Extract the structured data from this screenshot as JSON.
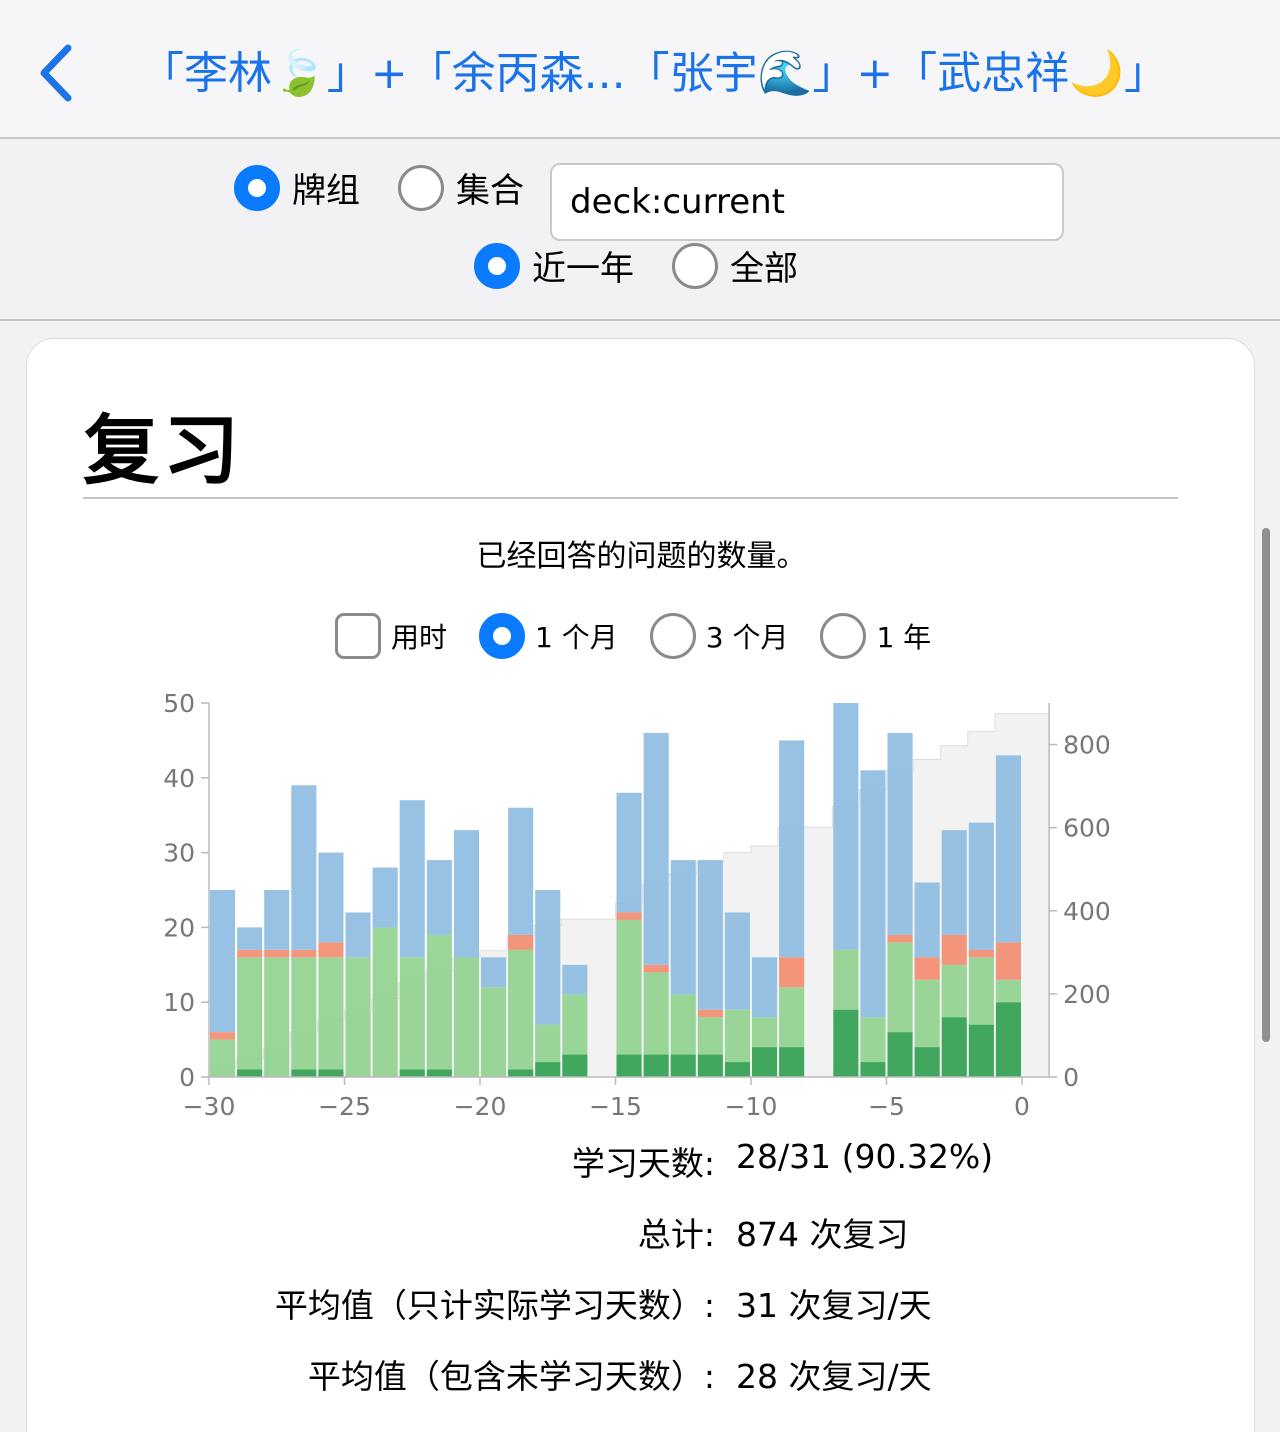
{
  "nav": {
    "back_icon": "chevron-left-icon",
    "title": "「李林🍃」+「余丙森...「张宇🌊」+「武忠祥🌙」",
    "accent": "#1a73e8"
  },
  "filters": {
    "scope_options": [
      {
        "label": "牌组",
        "selected": true
      },
      {
        "label": "集合",
        "selected": false
      }
    ],
    "search_value": "deck:current",
    "period_options": [
      {
        "label": "近一年",
        "selected": true
      },
      {
        "label": "全部",
        "selected": false
      }
    ]
  },
  "card": {
    "title": "复习",
    "subtitle": "已经回答的问题的数量。",
    "time_checkbox": {
      "label": "用时",
      "checked": false
    },
    "range_options": [
      {
        "label": "1 个月",
        "selected": true
      },
      {
        "label": "3 个月",
        "selected": false
      },
      {
        "label": "1 年",
        "selected": false
      }
    ]
  },
  "chart_data": {
    "type": "bar",
    "stacked": true,
    "x": [
      -30,
      -29,
      -28,
      -27,
      -26,
      -25,
      -24,
      -23,
      -22,
      -21,
      -20,
      -19,
      -18,
      -17,
      -16,
      -15,
      -14,
      -13,
      -12,
      -11,
      -10,
      -9,
      -8,
      -7,
      -6,
      -5,
      -4,
      -3,
      -2,
      -1,
      0
    ],
    "series": [
      {
        "key": "mature",
        "color": "#2e9e4f",
        "values": [
          0,
          1,
          0,
          1,
          1,
          0,
          0,
          1,
          1,
          0,
          0,
          1,
          2,
          3,
          0,
          3,
          3,
          3,
          3,
          2,
          4,
          4,
          0,
          9,
          2,
          6,
          4,
          8,
          7,
          10,
          0
        ]
      },
      {
        "key": "young",
        "color": "#8fd18c",
        "values": [
          5,
          15,
          16,
          15,
          15,
          16,
          20,
          15,
          18,
          16,
          12,
          16,
          5,
          8,
          0,
          18,
          11,
          8,
          5,
          7,
          4,
          8,
          0,
          8,
          6,
          12,
          9,
          7,
          9,
          3,
          0
        ]
      },
      {
        "key": "relearn",
        "color": "#f28b6e",
        "values": [
          1,
          1,
          1,
          1,
          2,
          0,
          0,
          0,
          0,
          0,
          0,
          2,
          0,
          0,
          0,
          1,
          1,
          0,
          1,
          0,
          0,
          4,
          0,
          0,
          0,
          1,
          3,
          4,
          1,
          5,
          0
        ]
      },
      {
        "key": "review",
        "color": "#8dbbe0",
        "values": [
          19,
          3,
          8,
          22,
          12,
          6,
          8,
          21,
          10,
          17,
          4,
          17,
          18,
          4,
          0,
          16,
          31,
          18,
          20,
          13,
          8,
          29,
          0,
          33,
          33,
          27,
          10,
          14,
          17,
          25,
          0
        ]
      }
    ],
    "cumulative": [
      25,
      45,
      70,
      109,
      139,
      161,
      189,
      226,
      255,
      288,
      304,
      340,
      365,
      380,
      380,
      418,
      464,
      489,
      518,
      540,
      556,
      601,
      601,
      651,
      692,
      738,
      764,
      797,
      831,
      874,
      874
    ],
    "x_ticks": [
      -30,
      -25,
      -20,
      -15,
      -10,
      -5,
      0
    ],
    "y_ticks": [
      0,
      10,
      20,
      30,
      40,
      50
    ],
    "y2_ticks": [
      0,
      200,
      400,
      600,
      800
    ],
    "ylim": [
      0,
      50
    ],
    "y2lim": [
      0,
      900
    ],
    "xlim": [
      -30,
      0
    ]
  },
  "stats": [
    {
      "label": "学习天数:",
      "value": "28/31 (90.32%)"
    },
    {
      "label": "总计:",
      "value": "874 次复习"
    },
    {
      "label": "平均值（只计实际学习天数）:",
      "value": "31 次复习/天"
    },
    {
      "label": "平均值（包含未学习天数）:",
      "value": "28 次复习/天"
    }
  ]
}
